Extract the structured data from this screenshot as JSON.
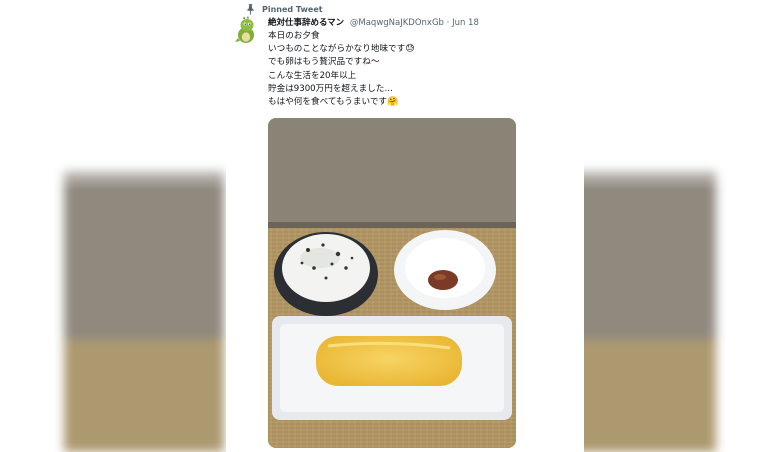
{
  "tweet": {
    "pinned_label": "Pinned Tweet",
    "display_name": "絶対仕事辞めるマン",
    "handle": "@MaqwgNaJKDOnxGb",
    "separator": "·",
    "date": "Jun 18",
    "lines": [
      "本日のお夕食",
      "いつものことながらかなり地味です",
      "でも卵はもう贅沢品ですね～",
      "こんな生活を20年以上",
      "貯金は9300万円を超えました…",
      "もはや何を食べてもうまいです"
    ],
    "emoji_line2": "😓",
    "emoji_line6": "🤗"
  },
  "icons": {
    "pin": "pin-icon",
    "avatar": "dinosaur-avatar-icon"
  },
  "colors": {
    "text_primary": "#0f1419",
    "text_secondary": "#536471",
    "wall": "#8a8476",
    "tatami": "#b49a67",
    "egg": "#f2c94c",
    "plate": "#eef1f4"
  }
}
